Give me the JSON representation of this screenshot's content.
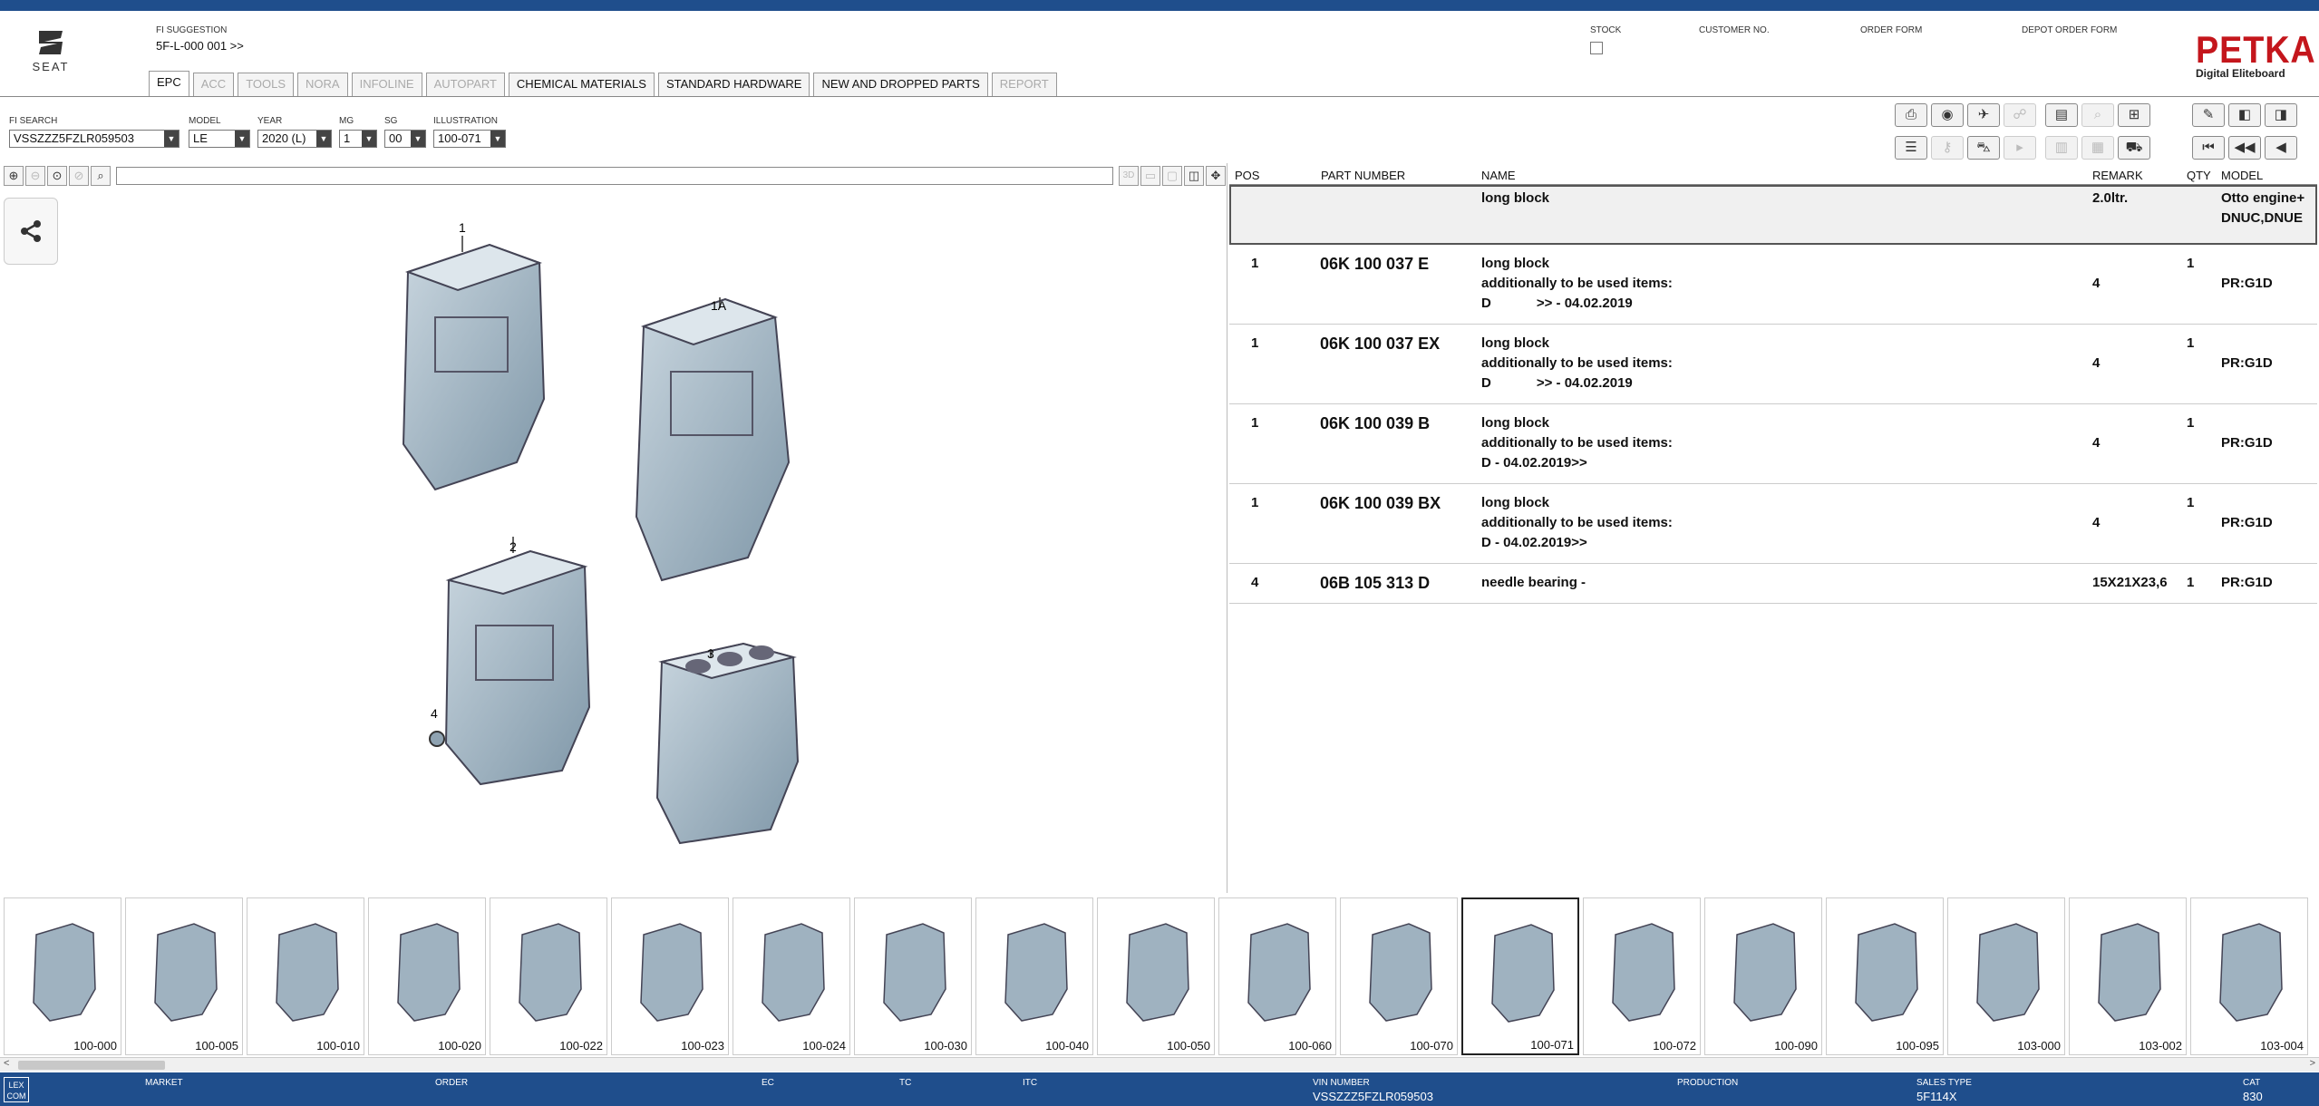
{
  "brand": {
    "seat_word": "SEAT",
    "petka": "PETKA",
    "petka_sub": "Digital Eliteboard"
  },
  "header": {
    "fi_suggestion_label": "FI SUGGESTION",
    "fi_suggestion_value": "5F-L-000 001 >>",
    "stock_label": "STOCK",
    "customer_no_label": "CUSTOMER NO.",
    "order_form_label": "ORDER FORM",
    "depot_order_form_label": "DEPOT ORDER FORM"
  },
  "tabs": [
    {
      "label": "EPC",
      "state": "active"
    },
    {
      "label": "ACC",
      "state": "disabled"
    },
    {
      "label": "TOOLS",
      "state": "disabled"
    },
    {
      "label": "NORA",
      "state": "disabled"
    },
    {
      "label": "INFOLINE",
      "state": "disabled"
    },
    {
      "label": "AUTOPART",
      "state": "disabled"
    },
    {
      "label": "CHEMICAL MATERIALS",
      "state": "enabled"
    },
    {
      "label": "STANDARD HARDWARE",
      "state": "enabled"
    },
    {
      "label": "NEW AND DROPPED PARTS",
      "state": "enabled"
    },
    {
      "label": "REPORT",
      "state": "disabled"
    }
  ],
  "selectors": {
    "fi_search": {
      "label": "FI SEARCH",
      "value": "VSSZZZ5FZLR059503"
    },
    "model": {
      "label": "MODEL",
      "value": "LE"
    },
    "year": {
      "label": "YEAR",
      "value": "2020 (L)"
    },
    "mg": {
      "label": "MG",
      "value": "1"
    },
    "sg": {
      "label": "SG",
      "value": "00"
    },
    "illustration": {
      "label": "ILLUSTRATION",
      "value": "100-071"
    }
  },
  "view_toolbar": {
    "btn_3d": "3D"
  },
  "illustration_labels": {
    "l1": "1",
    "l1a": "1A",
    "l2": "2",
    "l3": "3",
    "l4": "4"
  },
  "parts_table": {
    "headers": {
      "pos": "POS",
      "part_number": "PART NUMBER",
      "name": "NAME",
      "remark": "REMARK",
      "qty": "QTY",
      "model": "MODEL"
    },
    "header_row": {
      "name": "long block",
      "remark": "2.0ltr.",
      "model_l1": "Otto engine+",
      "model_l2": "DNUC,DNUE"
    },
    "rows": [
      {
        "pos": "1",
        "part": "06K 100 037 E",
        "name": "long block",
        "name2": "additionally to be used items:",
        "name3": "D            >> - 04.02.2019",
        "remark": "4",
        "qty": "1",
        "model": "PR:G1D"
      },
      {
        "pos": "1",
        "part": "06K 100 037 EX",
        "name": "long block",
        "name2": "additionally to be used items:",
        "name3": "D            >> - 04.02.2019",
        "remark": "4",
        "qty": "1",
        "model": "PR:G1D"
      },
      {
        "pos": "1",
        "part": "06K 100 039 B",
        "name": "long block",
        "name2": "additionally to be used items:",
        "name3": "D - 04.02.2019>>",
        "remark": "4",
        "qty": "1",
        "model": "PR:G1D"
      },
      {
        "pos": "1",
        "part": "06K 100 039 BX",
        "name": "long block",
        "name2": "additionally to be used items:",
        "name3": "D - 04.02.2019>>",
        "remark": "4",
        "qty": "1",
        "model": "PR:G1D"
      },
      {
        "pos": "4",
        "part": "06B 105 313 D",
        "name": "needle bearing -",
        "name2": "",
        "name3": "",
        "remark": "15X21X23,6",
        "qty": "1",
        "model": "PR:G1D"
      }
    ]
  },
  "thumbnails": [
    "100-000",
    "100-005",
    "100-010",
    "100-020",
    "100-022",
    "100-023",
    "100-024",
    "100-030",
    "100-040",
    "100-050",
    "100-060",
    "100-070",
    "100-071",
    "100-072",
    "100-090",
    "100-095",
    "103-000",
    "103-002",
    "103-004"
  ],
  "thumbnail_selected": "100-071",
  "status_bar": {
    "lexcom": "LEX COM",
    "market_label": "MARKET",
    "order_label": "ORDER",
    "ec_label": "EC",
    "tc_label": "TC",
    "itc_label": "ITC",
    "vin_label": "VIN NUMBER",
    "vin_value": "VSSZZZ5FZLR059503",
    "production_label": "PRODUCTION",
    "sales_type_label": "SALES TYPE",
    "sales_type_value": "5F114X",
    "cat_label": "CAT",
    "cat_value": "830"
  },
  "icons": {
    "top_left": [
      "print-icon",
      "vin-decode-icon",
      "vehicle-info-icon",
      "ref-icon",
      "elsa-icon",
      "search-disabled-icon",
      "cart-add-icon"
    ],
    "top_right": [
      "pin-icon",
      "prev-page-icon",
      "next-page-icon"
    ],
    "bottom_left": [
      "list-icon",
      "key-icon",
      "car-icon",
      "arrow-disabled-icon",
      "doc-disabled-icon",
      "stack-disabled-icon",
      "cart-icon"
    ],
    "bottom_right": [
      "first-icon",
      "previous-icon",
      "back-icon"
    ]
  }
}
